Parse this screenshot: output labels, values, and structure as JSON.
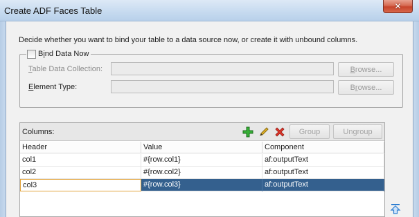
{
  "window": {
    "title": "Create ADF Faces Table",
    "close_glyph": "✕"
  },
  "instructions": "Decide whether you want to bind your table to a data source now, or create it with unbound columns.",
  "bind_group": {
    "checkbox_label_prefix": "B",
    "checkbox_label_underline": "i",
    "checkbox_label_rest": "nd Data Now",
    "checked": false,
    "fields": [
      {
        "label_prefix": "",
        "label_underline": "T",
        "label_rest": "able Data Collection:",
        "value": "",
        "enabled": false,
        "browse_prefix": "",
        "browse_underline": "B",
        "browse_rest": "rowse..."
      },
      {
        "label_prefix": "",
        "label_underline": "E",
        "label_rest": "lement Type:",
        "value": "",
        "enabled": false,
        "browse_prefix": "B",
        "browse_underline": "r",
        "browse_rest": "owse..."
      }
    ]
  },
  "columns": {
    "label": "Columns:",
    "toolbar": {
      "add_icon": "add-icon",
      "edit_icon": "edit-icon",
      "delete_icon": "delete-icon",
      "group_label": "Group",
      "ungroup_label": "Ungroup"
    },
    "headers": [
      "Header",
      "Value",
      "Component"
    ],
    "rows": [
      {
        "header": "col1",
        "value": "#{row.col1}",
        "component": "af:outputText",
        "selected": false
      },
      {
        "header": "col2",
        "value": "#{row.col2}",
        "component": "af:outputText",
        "selected": false
      },
      {
        "header": "col3",
        "value": "#{row.col3}",
        "component": "af:outputText",
        "selected": true
      }
    ]
  },
  "side_controls": {
    "move_top_icon": "move-to-top-icon"
  },
  "colors": {
    "selection": "#34608e",
    "add_icon": "#2e9e2e",
    "delete_icon": "#d0261c",
    "edit_icon": "#d1a21d",
    "arrow_icon": "#2f7fd1"
  }
}
